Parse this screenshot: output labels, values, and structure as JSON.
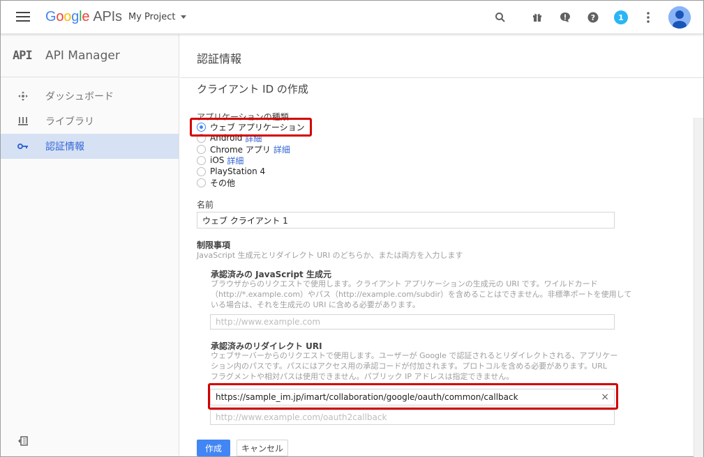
{
  "topbar": {
    "brand": {
      "g": "G",
      "o1": "o",
      "o2": "o",
      "g2": "g",
      "l": "l",
      "e": "e",
      "apis": "APIs"
    },
    "project": "My Project",
    "notification_count": "1",
    "icons": [
      "menu-icon",
      "search-icon",
      "gift-icon",
      "feedback-icon",
      "help-icon",
      "more-vert-icon",
      "account-icon"
    ]
  },
  "sidebar": {
    "api_mark": "API",
    "title": "API Manager",
    "items": [
      {
        "label": "ダッシュボード",
        "icon": "dashboard-icon"
      },
      {
        "label": "ライブラリ",
        "icon": "library-icon"
      },
      {
        "label": "認証情報",
        "icon": "key-icon"
      }
    ]
  },
  "main": {
    "title": "認証情報",
    "subtitle": "クライアント ID の作成",
    "app_type_label": "アプリケーションの種類",
    "app_types": [
      {
        "label": "ウェブ アプリケーション",
        "link": "",
        "selected": true
      },
      {
        "label": "Android",
        "link": "詳細",
        "selected": false
      },
      {
        "label": "Chrome アプリ",
        "link": "詳細",
        "selected": false
      },
      {
        "label": "iOS",
        "link": "詳細",
        "selected": false
      },
      {
        "label": "PlayStation 4",
        "link": "",
        "selected": false
      },
      {
        "label": "その他",
        "link": "",
        "selected": false
      }
    ],
    "name_label": "名前",
    "name_value": "ウェブ クライアント 1",
    "restrictions_label": "制限事項",
    "restrictions_desc": "JavaScript 生成元とリダイレクト URI のどちらか、または両方を入力します",
    "js_origin": {
      "label": "承認済みの JavaScript 生成元",
      "desc_1": "ブラウザからのリクエストで使用します。クライアント アプリケーションの生成元の URI です。ワイルドカード",
      "desc_2": "（http://*.example.com）やパス（http://example.com/subdir）を含めることはできません。非標準ポートを使用して",
      "desc_3": "いる場合は、それを生成元の URI に含める必要があります。",
      "placeholder": "http://www.example.com"
    },
    "redirect": {
      "label": "承認済みのリダイレクト URI",
      "desc_1": "ウェブサーバーからのリクエストで使用します。ユーザーが Google で認証されるとリダイレクトされる、アプリケー",
      "desc_2": "ション内のパスです。パスにはアクセス用の承認コードが付加されます。プロトコルを含める必要があります。URL",
      "desc_3": "フラグメントや相対パスは使用できません。パブリック IP アドレスは指定できません。",
      "value": "https://sample_im.jp/imart/collaboration/google/oauth/common/callback",
      "clear": "×",
      "placeholder": "http://www.example.com/oauth2callback"
    },
    "create_button": "作成",
    "cancel_button": "キャンセル"
  },
  "colors": {
    "accent": "#4285f4",
    "highlight": "#d30000",
    "active_bg": "#d6e1f4"
  }
}
